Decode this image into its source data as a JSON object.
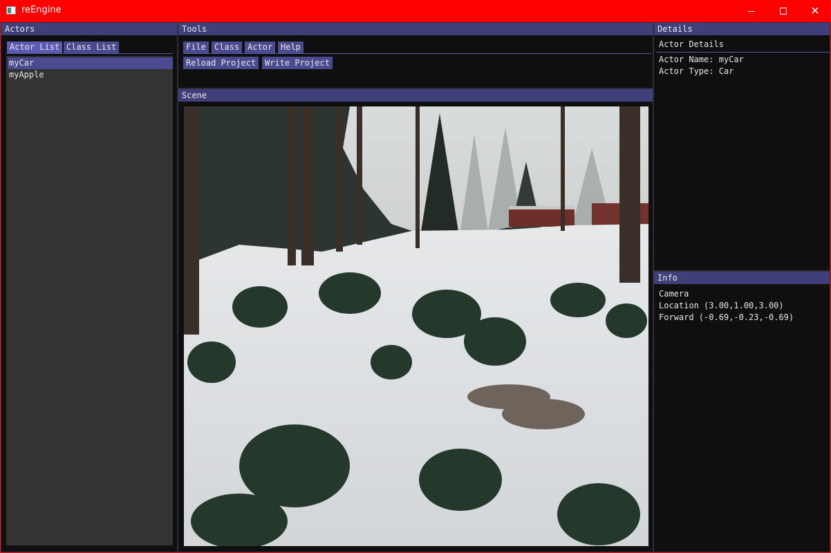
{
  "window": {
    "title": "reEngine",
    "minimize_glyph": "minimize-icon",
    "maximize_glyph": "maximize-icon",
    "close_glyph": "✕"
  },
  "actors_panel": {
    "title": "Actors",
    "tabs": [
      {
        "label": "Actor List",
        "active": true
      },
      {
        "label": "Class List",
        "active": false
      }
    ],
    "items": [
      {
        "label": "myCar",
        "selected": true
      },
      {
        "label": "myApple",
        "selected": false
      }
    ]
  },
  "tools_panel": {
    "title": "Tools",
    "menu": [
      {
        "label": "File"
      },
      {
        "label": "Class"
      },
      {
        "label": "Actor"
      },
      {
        "label": "Help"
      }
    ],
    "buttons": [
      {
        "label": "Reload Project"
      },
      {
        "label": "Write Project"
      }
    ]
  },
  "scene_panel": {
    "title": "Scene"
  },
  "details_panel": {
    "title": "Details",
    "tab": "Actor Details",
    "actor_name": "Actor Name: myCar",
    "actor_type": "Actor Type: Car"
  },
  "info_panel": {
    "title": "Info",
    "camera": "Camera",
    "location": "Location (3.00,1.00,3.00)",
    "forward": "Forward (-0.69,-0.23,-0.69)"
  },
  "colors": {
    "titlebar": "#ff0000",
    "panel_header": "#3f3f7a",
    "tab": "#4a4a90",
    "tab_active": "#5b5bb4",
    "list_bg": "#333333",
    "window_bg": "#0f0f0f"
  }
}
